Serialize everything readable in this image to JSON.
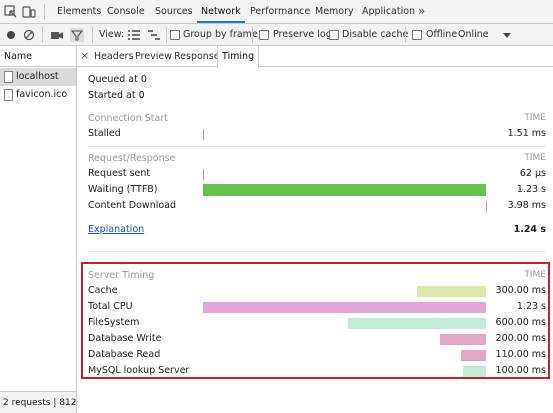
{
  "devtools": {
    "tabs": [
      "Elements",
      "Console",
      "Sources",
      "Network",
      "Performance",
      "Memory",
      "Application"
    ],
    "active_tab": "Network",
    "more": "»"
  },
  "toolbar": {
    "view_label": "View:",
    "group_by_frame": "Group by frame",
    "preserve_log": "Preserve log",
    "disable_cache": "Disable cache",
    "offline": "Offline",
    "online": "Online"
  },
  "requests": {
    "header": "Name",
    "items": [
      "localhost",
      "favicon.ico"
    ],
    "status": "2 requests | 812..."
  },
  "detail_tabs": {
    "close": "×",
    "items": [
      "Headers",
      "Preview",
      "Response",
      "Timing"
    ],
    "active": "Timing"
  },
  "timing": {
    "queued": "Queued at 0",
    "started": "Started at 0",
    "time_header": "TIME",
    "connection_start": {
      "title": "Connection Start",
      "rows": [
        {
          "label": "Stalled",
          "value": "1.51 ms",
          "start": 0,
          "end": 0
        }
      ]
    },
    "request_response": {
      "title": "Request/Response",
      "rows": [
        {
          "label": "Request sent",
          "value": "62 µs",
          "start": 0,
          "end": 0
        },
        {
          "label": "Waiting (TTFB)",
          "value": "1.23 s",
          "start": 0.0,
          "end": 1.0
        },
        {
          "label": "Content Download",
          "value": "3.98 ms",
          "start": 1.0,
          "end": 1.0
        }
      ]
    },
    "explanation": "Explanation",
    "total": "1.24 s",
    "server_timing": {
      "title": "Server Timing",
      "rows": [
        {
          "label": "Cache",
          "value": "300.00 ms",
          "ms": 300,
          "color": "#dbe8a8"
        },
        {
          "label": "Total CPU",
          "value": "1.23 s",
          "ms": 1230,
          "color": "#e4a6da"
        },
        {
          "label": "FileSystem",
          "value": "600.00 ms",
          "ms": 600,
          "color": "#c2ecd7"
        },
        {
          "label": "Database Write",
          "value": "200.00 ms",
          "ms": 200,
          "color": "#e4a7c3"
        },
        {
          "label": "Database Read",
          "value": "110.00 ms",
          "ms": 110,
          "color": "#e4a7c3"
        },
        {
          "label": "MySQL lookup Server",
          "value": "100.00 ms",
          "ms": 100,
          "color": "#c2ecd7"
        }
      ],
      "scale_ms": 1230
    },
    "colors": {
      "waiting": "#65c24f",
      "highlight": "#c8202a"
    }
  }
}
